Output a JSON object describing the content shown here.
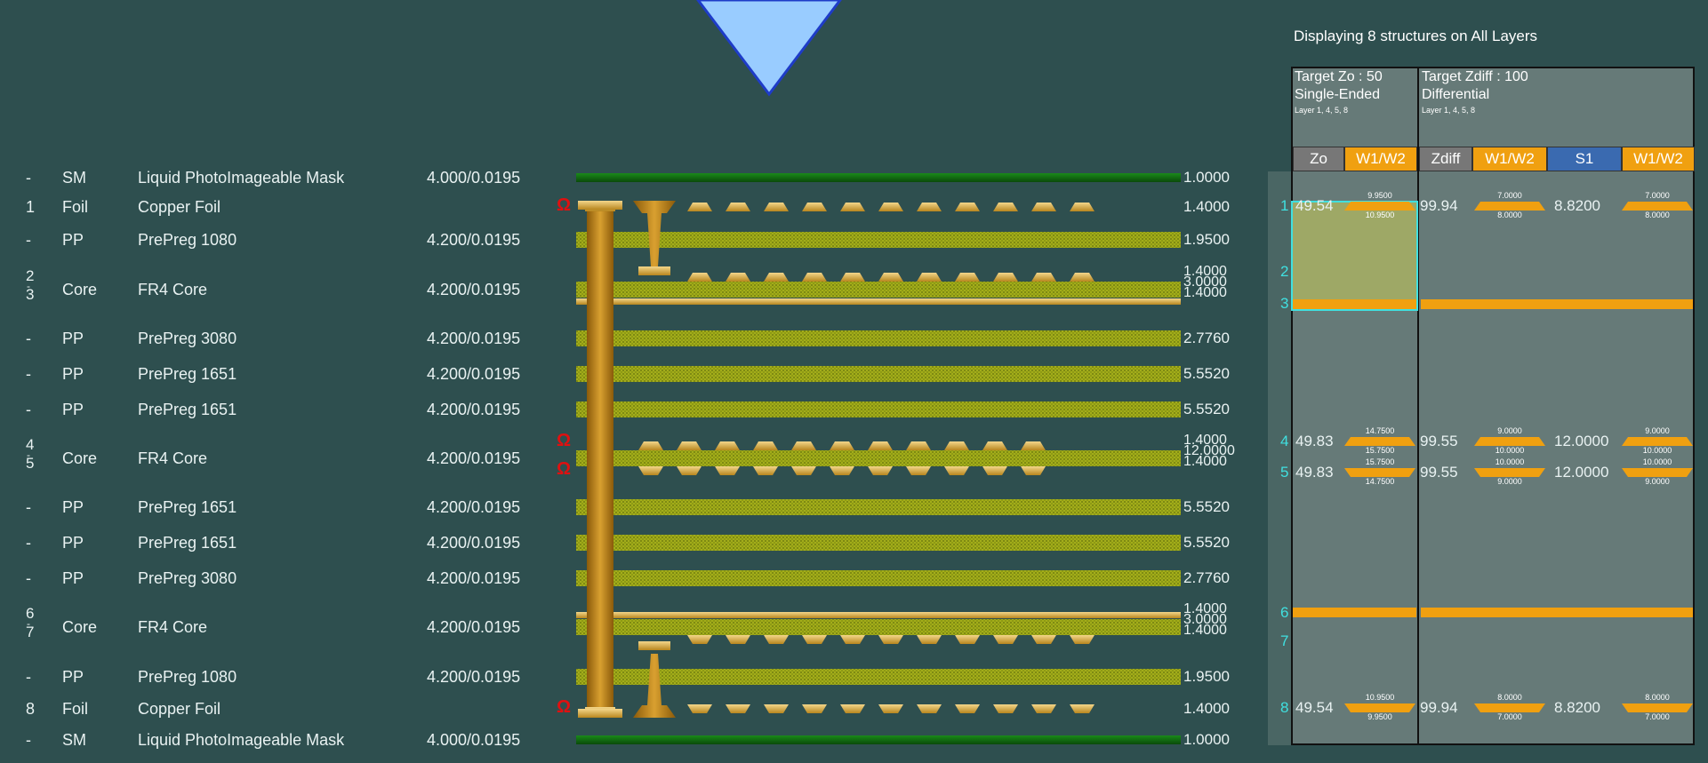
{
  "summary": "Displaying 8 structures on All Layers",
  "columns_single": {
    "title_target": "Target Zo : 50",
    "title_mode": "Single-Ended",
    "title_layers": "Layer 1, 4, 5, 8",
    "headers": [
      "Zo",
      "W1/W2"
    ]
  },
  "columns_diff": {
    "title_target": "Target Zdiff : 100",
    "title_mode": "Differential",
    "title_layers": "Layer 1, 4, 5, 8",
    "headers": [
      "Zdiff",
      "W1/W2",
      "S1",
      "W1/W2"
    ]
  },
  "colors": {
    "background": "#2e4f4f",
    "panel": "#667a78",
    "header_orange": "#f0a010",
    "header_blue": "#3a6ab0",
    "cyan": "#40e0e0",
    "dielectric_green": "#9aa816",
    "copper": "#c98a1a",
    "mask_green": "#0f6b0f",
    "omega_red": "#e01010",
    "indicator_blue": "#99ccff"
  },
  "stack": [
    {
      "layer": "-",
      "type": "SM",
      "material": "Liquid PhotoImageable Mask",
      "dk": "4.000/0.0195",
      "thickness": [
        "1.0000"
      ]
    },
    {
      "layer": "1",
      "type": "Foil",
      "material": "Copper Foil",
      "dk": "",
      "thickness": [
        "1.4000"
      ]
    },
    {
      "layer": "-",
      "type": "PP",
      "material": "PrePreg 1080",
      "dk": "4.200/0.0195",
      "thickness": [
        "1.9500"
      ]
    },
    {
      "layer": "2",
      "layer_end": "3",
      "type": "Core",
      "material": "FR4 Core",
      "dk": "4.200/0.0195",
      "thickness": [
        "1.4000",
        "3.0000",
        "1.4000"
      ]
    },
    {
      "layer": "-",
      "type": "PP",
      "material": "PrePreg 3080",
      "dk": "4.200/0.0195",
      "thickness": [
        "2.7760"
      ]
    },
    {
      "layer": "-",
      "type": "PP",
      "material": "PrePreg 1651",
      "dk": "4.200/0.0195",
      "thickness": [
        "5.5520"
      ]
    },
    {
      "layer": "-",
      "type": "PP",
      "material": "PrePreg 1651",
      "dk": "4.200/0.0195",
      "thickness": [
        "5.5520"
      ]
    },
    {
      "layer": "4",
      "layer_end": "5",
      "type": "Core",
      "material": "FR4 Core",
      "dk": "4.200/0.0195",
      "thickness": [
        "1.4000",
        "12.0000",
        "1.4000"
      ]
    },
    {
      "layer": "-",
      "type": "PP",
      "material": "PrePreg 1651",
      "dk": "4.200/0.0195",
      "thickness": [
        "5.5520"
      ]
    },
    {
      "layer": "-",
      "type": "PP",
      "material": "PrePreg 1651",
      "dk": "4.200/0.0195",
      "thickness": [
        "5.5520"
      ]
    },
    {
      "layer": "-",
      "type": "PP",
      "material": "PrePreg 3080",
      "dk": "4.200/0.0195",
      "thickness": [
        "2.7760"
      ]
    },
    {
      "layer": "6",
      "layer_end": "7",
      "type": "Core",
      "material": "FR4 Core",
      "dk": "4.200/0.0195",
      "thickness": [
        "1.4000",
        "3.0000",
        "1.4000"
      ]
    },
    {
      "layer": "-",
      "type": "PP",
      "material": "PrePreg 1080",
      "dk": "4.200/0.0195",
      "thickness": [
        "1.9500"
      ]
    },
    {
      "layer": "8",
      "type": "Foil",
      "material": "Copper Foil",
      "dk": "",
      "thickness": [
        "1.4000"
      ]
    },
    {
      "layer": "-",
      "type": "SM",
      "material": "Liquid PhotoImageable Mask",
      "dk": "4.000/0.0195",
      "thickness": [
        "1.0000"
      ]
    }
  ],
  "layer_markers": [
    "1",
    "2",
    "3",
    "4",
    "5",
    "6",
    "7",
    "8"
  ],
  "results": [
    {
      "layer": "1",
      "zo": "49.54",
      "w_top": "9.9500",
      "w_bot": "10.9500",
      "zdiff": "99.94",
      "dw_top": "7.0000",
      "dw_bot": "8.0000",
      "s1": "8.8200",
      "dw2_top": "7.0000",
      "dw2_bot": "8.0000"
    },
    {
      "layer": "4",
      "zo": "49.83",
      "w_top": "14.7500",
      "w_bot": "15.7500",
      "zdiff": "99.55",
      "dw_top": "9.0000",
      "dw_bot": "10.0000",
      "s1": "12.0000",
      "dw2_top": "9.0000",
      "dw2_bot": "10.0000"
    },
    {
      "layer": "5",
      "zo": "49.83",
      "w_top": "15.7500",
      "w_bot": "14.7500",
      "zdiff": "99.55",
      "dw_top": "10.0000",
      "dw_bot": "9.0000",
      "s1": "12.0000",
      "dw2_top": "10.0000",
      "dw2_bot": "9.0000"
    },
    {
      "layer": "8",
      "zo": "49.54",
      "w_top": "10.9500",
      "w_bot": "9.9500",
      "zdiff": "99.94",
      "dw_top": "8.0000",
      "dw_bot": "7.0000",
      "s1": "8.8200",
      "dw2_top": "8.0000",
      "dw2_bot": "7.0000"
    }
  ],
  "icons": {
    "impedance": "omega-icon",
    "indicator": "triangle-down-icon"
  },
  "omega_glyph": "Ω"
}
